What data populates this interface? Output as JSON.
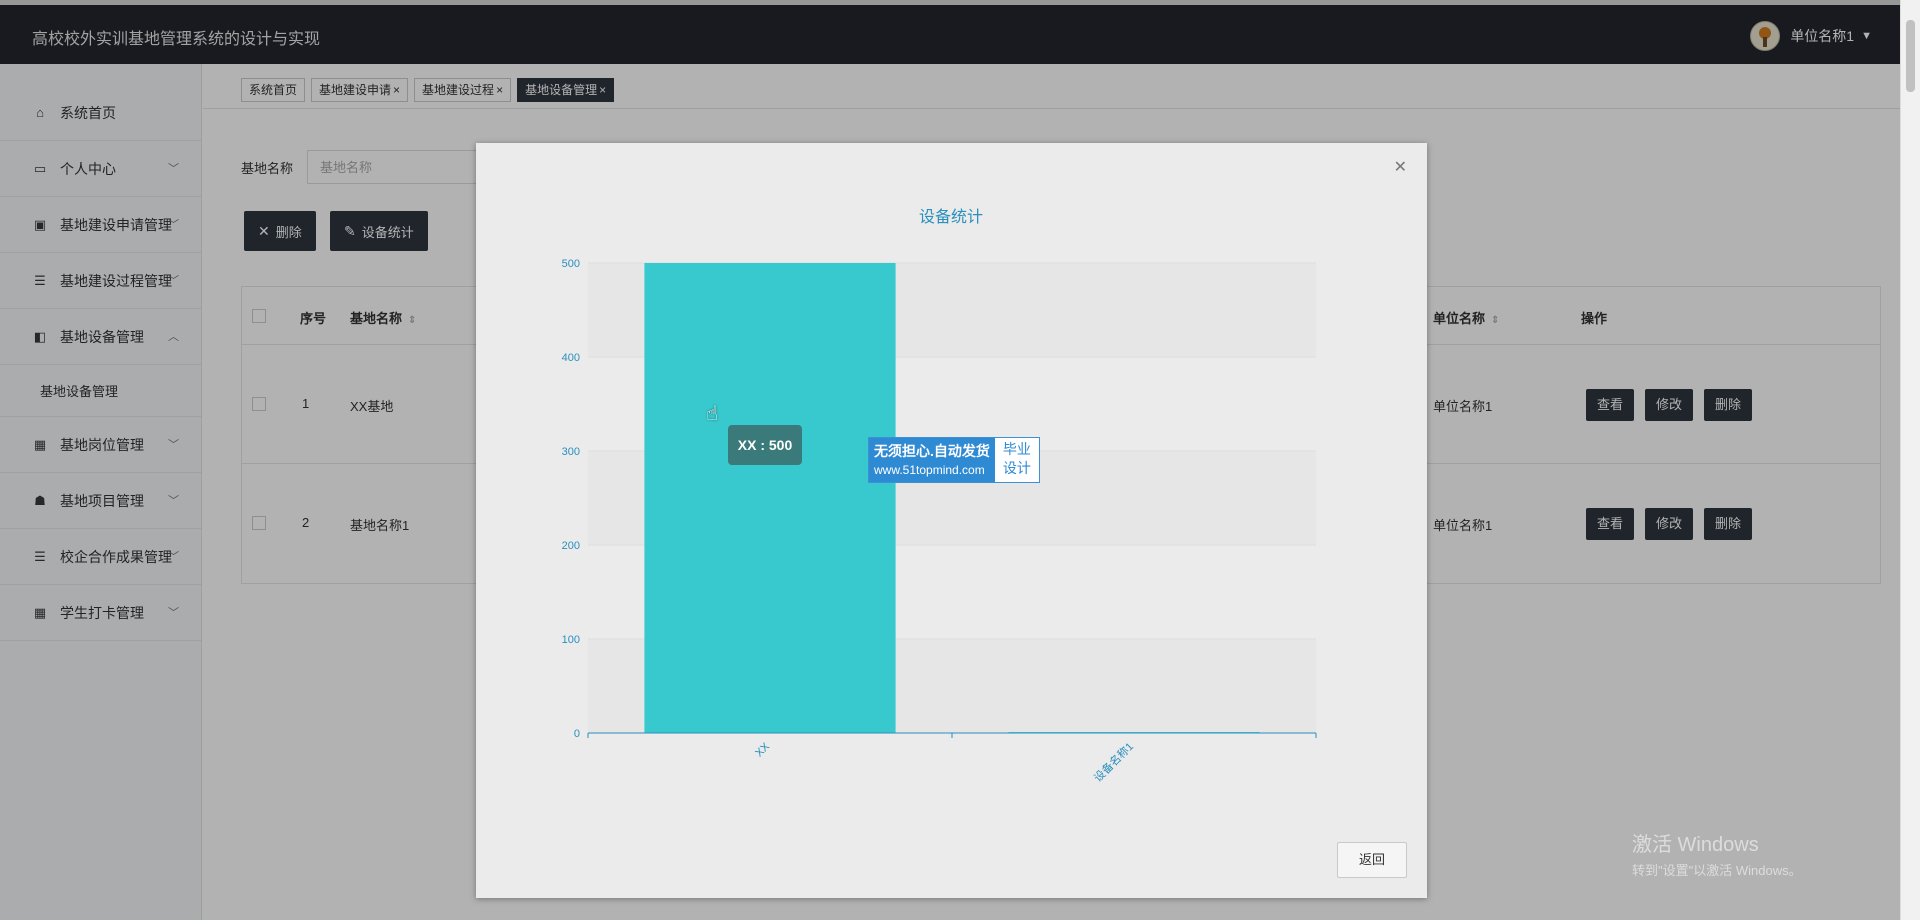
{
  "header": {
    "title": "高校校外实训基地管理系统的设计与实现",
    "user_name": "单位名称1"
  },
  "sidebar": {
    "items": [
      {
        "label": "系统首页",
        "icon": "home-icon"
      },
      {
        "label": "个人中心",
        "icon": "window-icon"
      },
      {
        "label": "基地建设申请管理",
        "icon": "clipboard-icon"
      },
      {
        "label": "基地建设过程管理",
        "icon": "list-icon"
      },
      {
        "label": "基地设备管理",
        "icon": "film-icon"
      },
      {
        "label": "基地岗位管理",
        "icon": "grid-icon"
      },
      {
        "label": "基地项目管理",
        "icon": "user-icon"
      },
      {
        "label": "校企合作成果管理",
        "icon": "list-icon"
      },
      {
        "label": "学生打卡管理",
        "icon": "grid-icon"
      }
    ],
    "sub_item": "基地设备管理"
  },
  "tabs": [
    {
      "label": "系统首页",
      "closable": false
    },
    {
      "label": "基地建设申请",
      "closable": true
    },
    {
      "label": "基地建设过程",
      "closable": true
    },
    {
      "label": "基地设备管理",
      "closable": true
    }
  ],
  "search": {
    "label": "基地名称",
    "placeholder": "基地名称"
  },
  "toolbar": {
    "delete_label": "删除",
    "stats_label": "设备统计"
  },
  "table": {
    "headers": {
      "index": "序号",
      "name": "基地名称",
      "unit": "单位名称",
      "ops": "操作"
    },
    "rows": [
      {
        "index": "1",
        "name": "XX基地",
        "unit": "单位名称1"
      },
      {
        "index": "2",
        "name": "基地名称1",
        "unit": "单位名称1"
      }
    ],
    "row_actions": {
      "view": "查看",
      "edit": "修改",
      "delete": "删除"
    }
  },
  "modal": {
    "return_label": "返回",
    "tooltip": "XX : 500",
    "ad_line1": "无须担心.自动发货",
    "ad_line2": "www.51topmind.com",
    "ad_right1": "毕业",
    "ad_right2": "设计"
  },
  "chart_data": {
    "type": "bar",
    "title": "设备统计",
    "categories": [
      "XX",
      "设备名称1"
    ],
    "values": [
      500,
      1
    ],
    "ylim": [
      0,
      500
    ],
    "yticks": [
      0,
      100,
      200,
      300,
      400,
      500
    ],
    "grid": true,
    "bar_color": "#37c9ce",
    "axis_color": "#2a8fbd"
  },
  "os_watermark": {
    "line1": "激活 Windows",
    "line2": "转到\"设置\"以激活 Windows。"
  },
  "colors": {
    "header_bg": "#23262e",
    "button_dark": "#2e3540",
    "accent_teal": "#37c9ce"
  }
}
